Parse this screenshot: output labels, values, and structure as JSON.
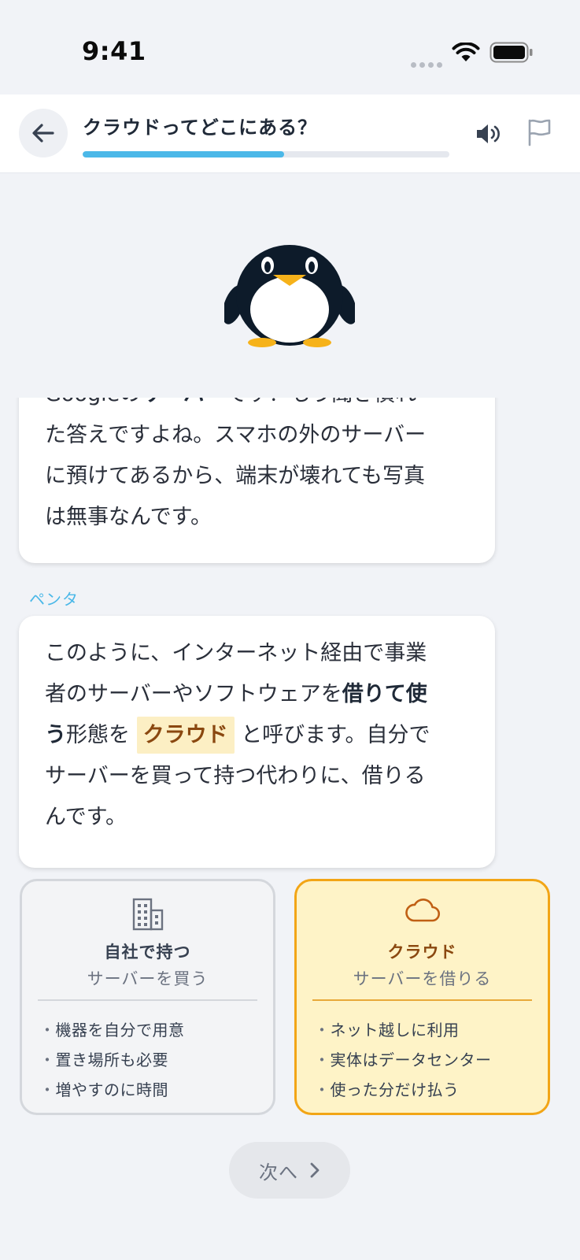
{
  "status_bar": {
    "time": "9:41"
  },
  "header": {
    "title": "クラウドってどこにある？",
    "progress_percent": 55,
    "icons": {
      "back": "arrow-left-icon",
      "sound": "speaker-icon",
      "flag": "flag-icon"
    }
  },
  "mascot": {
    "icon": "penguin-mascot"
  },
  "chat": {
    "message1": {
      "line0_pre": "Google",
      "line0_mid": "の",
      "line0_bold": "サーバー",
      "line0_post": "です！もう聞き慣れ",
      "line1": "た答えですよね。スマホの外のサーバー",
      "line2": "に預けてあるから、端末が壊れても写真",
      "line3": "は無事なんです。"
    },
    "speaker": "ペンタ",
    "message2": {
      "line0": "このように、インターネット経由で事業",
      "line1_pre": "者のサーバーやソフトウェアを",
      "line1_bold": "借りて使",
      "line2_bold": "う",
      "line2_mid": "形態を",
      "line2_term": "クラウド",
      "line2_post": "と呼びます。自分で",
      "line3": "サーバーを買って持つ代わりに、借りる",
      "line4": "んです。"
    }
  },
  "compare": {
    "self_owned": {
      "icon": "building-icon",
      "title": "自社で持つ",
      "subtitle": "サーバーを買う",
      "points": [
        "機器を自分で用意",
        "置き場所も必要",
        "増やすのに時間"
      ]
    },
    "cloud": {
      "icon": "cloud-icon",
      "title": "クラウド",
      "subtitle": "サーバーを借りる",
      "points": [
        "ネット越しに利用",
        "実体はデータセンター",
        "使った分だけ払う"
      ]
    },
    "colors": {
      "cloud_accent": "#f2a516",
      "cloud_text": "#8a4810",
      "progress": "#4bb8e8"
    }
  },
  "footer": {
    "next_label": "次へ",
    "next_icon": "chevron-right-icon"
  }
}
